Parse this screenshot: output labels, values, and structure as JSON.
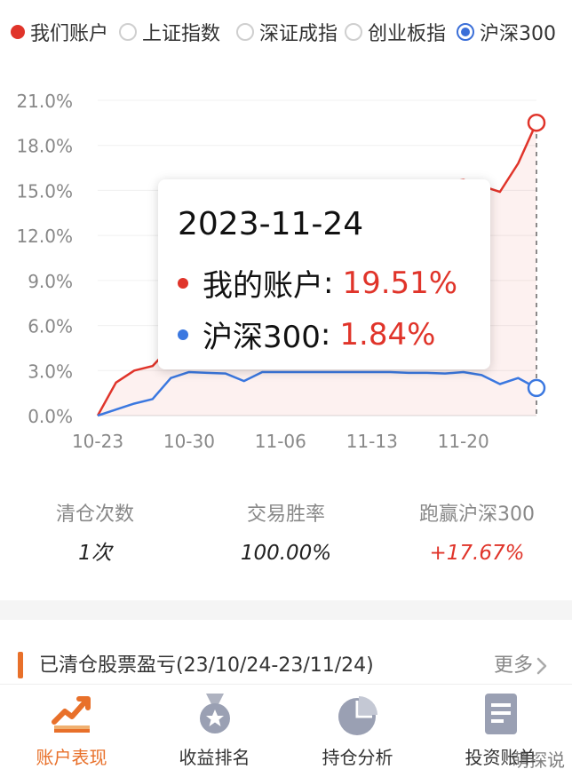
{
  "legend": {
    "items": [
      {
        "label": "我们账户",
        "state": "filled"
      },
      {
        "label": "上证指数",
        "state": "empty"
      },
      {
        "label": "深证成指",
        "state": "empty"
      },
      {
        "label": "创业板指",
        "state": "empty"
      },
      {
        "label": "沪深300",
        "state": "selected"
      }
    ]
  },
  "chart_data": {
    "type": "line",
    "ylim": [
      0,
      21
    ],
    "y_ticks": [
      "0.0%",
      "3.0%",
      "6.0%",
      "9.0%",
      "12.0%",
      "15.0%",
      "18.0%",
      "21.0%"
    ],
    "x_ticks": [
      "10-23",
      "10-30",
      "11-06",
      "11-13",
      "11-20"
    ],
    "x": [
      "10-23",
      "10-24",
      "10-25",
      "10-26",
      "10-27",
      "10-30",
      "10-31",
      "11-01",
      "11-02",
      "11-03",
      "11-06",
      "11-07",
      "11-08",
      "11-09",
      "11-10",
      "11-13",
      "11-14",
      "11-15",
      "11-16",
      "11-17",
      "11-20",
      "11-21",
      "11-22",
      "11-23",
      "11-24"
    ],
    "series": [
      {
        "name": "我的账户",
        "color": "#e0342a",
        "values": [
          0.0,
          2.2,
          3.0,
          3.3,
          4.6,
          5.2,
          6.1,
          7.0,
          7.8,
          8.6,
          9.3,
          10.0,
          10.7,
          11.4,
          12.1,
          12.8,
          13.5,
          14.2,
          14.9,
          15.5,
          15.7,
          15.3,
          14.9,
          16.8,
          19.51
        ]
      },
      {
        "name": "沪深300",
        "color": "#3b78e0",
        "values": [
          0.0,
          0.4,
          0.8,
          1.1,
          2.5,
          2.9,
          2.85,
          2.8,
          2.3,
          2.9,
          2.9,
          2.9,
          2.9,
          2.9,
          2.9,
          2.9,
          2.9,
          2.85,
          2.85,
          2.8,
          2.9,
          2.7,
          2.1,
          2.5,
          1.84
        ]
      }
    ],
    "tooltip": {
      "date": "2023-11-24",
      "rows": [
        {
          "name": "我的账户",
          "value": "19.51%",
          "color": "#e0342a"
        },
        {
          "name": "沪深300",
          "value": "1.84%",
          "color": "#3b78e0"
        }
      ]
    }
  },
  "stats": [
    {
      "label": "清仓次数",
      "value": "1次",
      "accent": false
    },
    {
      "label": "交易胜率",
      "value": "100.00%",
      "accent": false
    },
    {
      "label": "跑赢沪深300",
      "value": "+17.67%",
      "accent": true
    }
  ],
  "closed_section": {
    "title": "已清仓股票盈亏(23/10/24-23/11/24)",
    "more": "更多"
  },
  "tabbar": {
    "items": [
      {
        "label": "账户表现",
        "icon": "trend-chart-icon",
        "active": true
      },
      {
        "label": "收益排名",
        "icon": "medal-icon",
        "active": false
      },
      {
        "label": "持仓分析",
        "icon": "pie-chart-icon",
        "active": false
      },
      {
        "label": "投资账单",
        "icon": "bill-icon",
        "active": false
      }
    ]
  },
  "watermark": "萌探说",
  "colors": {
    "accent_red": "#e0342a",
    "accent_blue": "#3b78e0",
    "accent_orange": "#e8702a"
  }
}
